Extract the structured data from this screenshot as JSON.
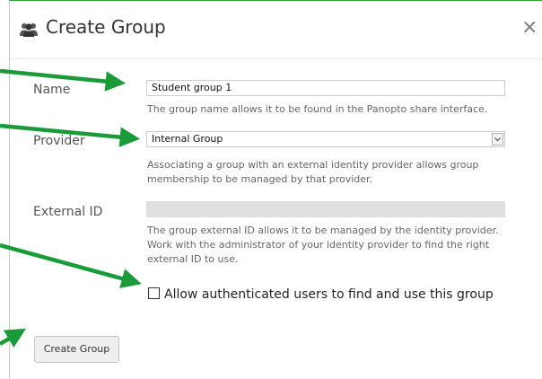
{
  "dialog": {
    "title": "Create Group",
    "title_icon": "users-icon",
    "close_icon": "close-icon",
    "close_glyph": "×"
  },
  "form": {
    "name": {
      "label": "Name",
      "value": "Student group 1",
      "help": "The group name allows it to be found in the Panopto share interface."
    },
    "provider": {
      "label": "Provider",
      "selected": "Internal Group",
      "help": "Associating a group with an external identity provider allows group membership to be managed by that provider."
    },
    "external_id": {
      "label": "External ID",
      "value": "",
      "help": "The group external ID allows it to be managed by the identity provider. Work with the administrator of your identity provider to find the right external ID to use."
    },
    "allow_authenticated": {
      "label": "Allow authenticated users to find and use this group",
      "checked": false
    },
    "submit_label": "Create Group"
  },
  "annotation": {
    "arrow_color": "#1a9b3a"
  }
}
